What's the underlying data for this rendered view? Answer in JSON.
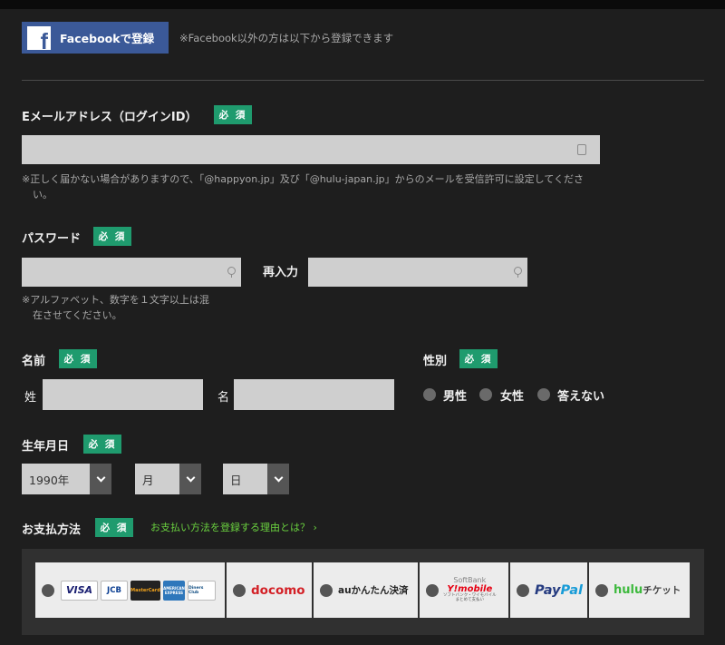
{
  "facebook": {
    "button_label": "Facebookで登録",
    "logo_letter": "f",
    "note": "※Facebook以外の方は以下から登録できます"
  },
  "required_label": "必 須",
  "email": {
    "label": "Eメールアドレス（ログインID）",
    "note_line1": "※正しく届かない場合がありますので、「@happyon.jp」及び「@hulu-japan.jp」からのメールを受信許可に設定してくださ",
    "note_line2": "い。"
  },
  "password": {
    "label": "パスワード",
    "confirm_label": "再入力",
    "note_line1": "※アルファベット、数字を１文字以上は混",
    "note_line2": "在させてください。"
  },
  "name": {
    "label": "名前",
    "last_label": "姓",
    "first_label": "名"
  },
  "gender": {
    "label": "性別",
    "options": [
      "男性",
      "女性",
      "答えない"
    ]
  },
  "birthday": {
    "label": "生年月日",
    "year": "1990年",
    "month": "月",
    "day": "日"
  },
  "payment": {
    "label": "お支払方法",
    "reason_link": "お支払い方法を登録する理由とは？ ›",
    "cards": [
      "VISA",
      "JCB",
      "MasterCard",
      "AMERICAN EXPRESS",
      "Diners Club"
    ],
    "docomo": "docomo",
    "au": "auかんたん決済",
    "softbank": {
      "brand": "SoftBank",
      "ymobile": "Y!mobile",
      "sub1": "ソフトバンク・ワイモバイル",
      "sub2": "まとめて支払い"
    },
    "paypal": {
      "pay": "Pay",
      "pal": "Pal"
    },
    "hulu": {
      "brand": "hulu",
      "suffix": "チケット"
    }
  },
  "colors": {
    "background": "#1e1e1e",
    "required_badge": "#1f9b6e",
    "facebook": "#3b5998",
    "link": "#6ad13f",
    "input": "#cfcfcf"
  }
}
